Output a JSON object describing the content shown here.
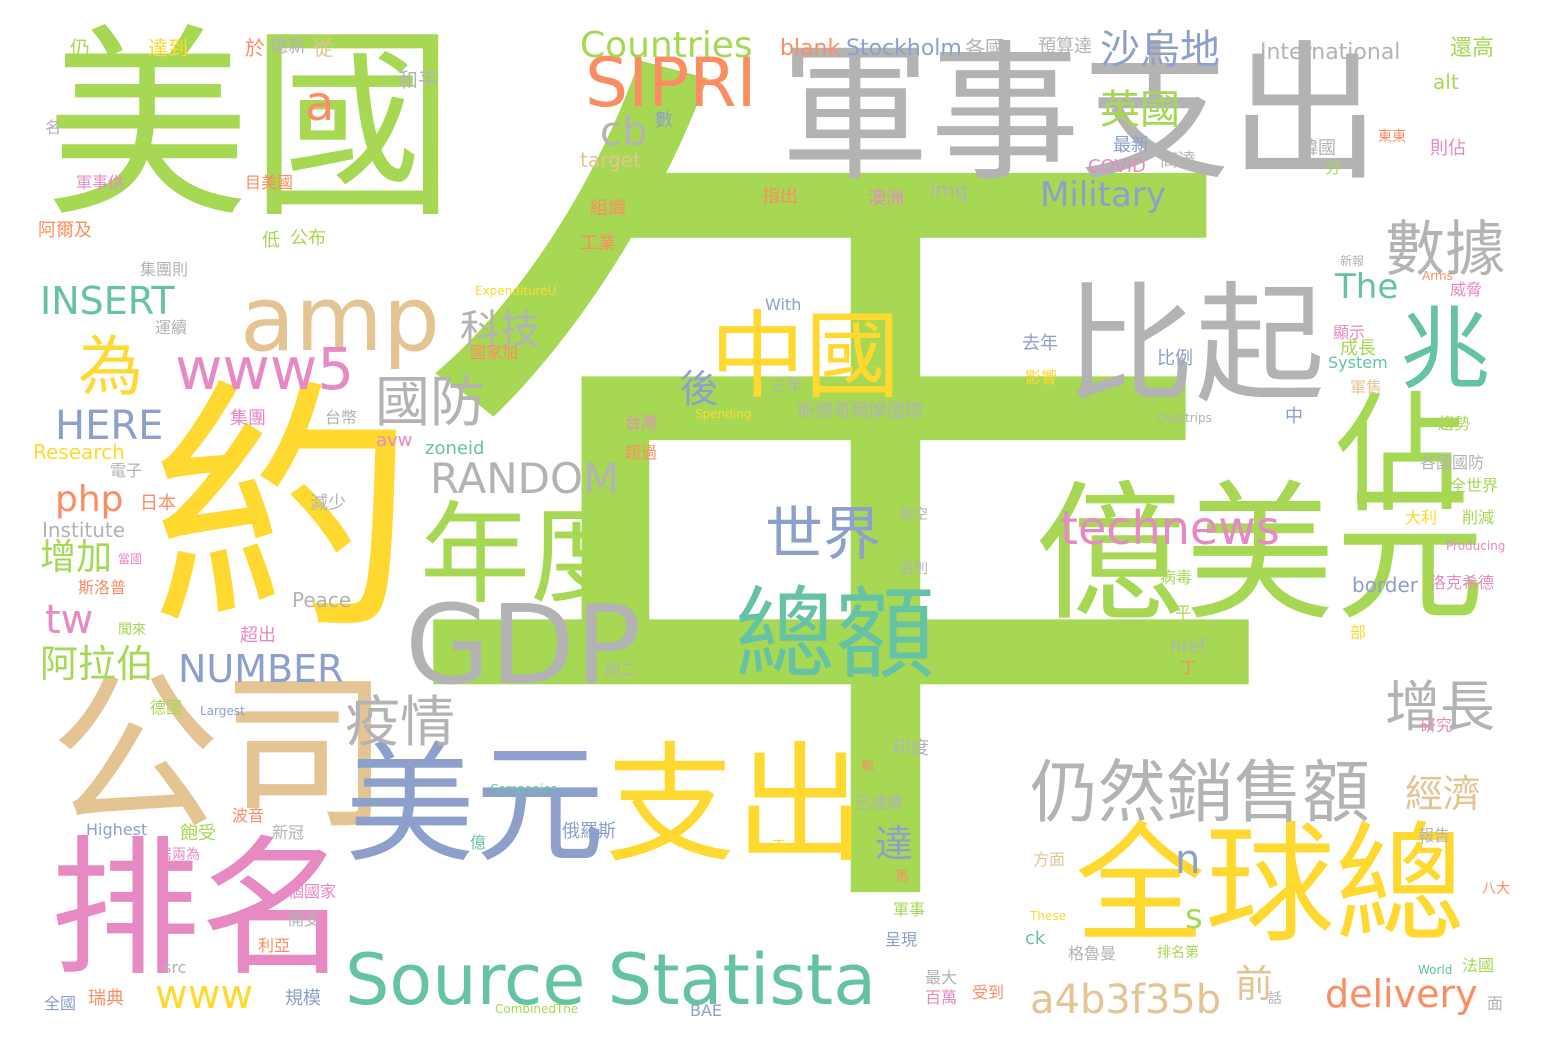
{
  "colors": {
    "green": "#a6d854",
    "yellow": "#ffd92f",
    "gray": "#b3b3b3",
    "tan": "#e5c494",
    "orange": "#fc8d62",
    "pink": "#e78ac3",
    "blue": "#8da0cb",
    "teal": "#66c2a5"
  },
  "words": [
    {
      "text": "年",
      "color": "green"
    },
    {
      "text": "美國",
      "color": "green"
    },
    {
      "text": "軍事支出",
      "color": "gray"
    },
    {
      "text": "約",
      "color": "yellow"
    },
    {
      "text": "億美元",
      "color": "green"
    },
    {
      "text": "公司",
      "color": "tan"
    },
    {
      "text": "排名",
      "color": "pink"
    },
    {
      "text": "比起",
      "color": "gray"
    },
    {
      "text": "美元",
      "color": "blue"
    },
    {
      "text": "支出",
      "color": "yellow"
    },
    {
      "text": "全球總",
      "color": "yellow"
    },
    {
      "text": "佔",
      "color": "green"
    },
    {
      "text": "GDP",
      "color": "gray"
    },
    {
      "text": "年度",
      "color": "green"
    },
    {
      "text": "總額",
      "color": "teal"
    },
    {
      "text": "中國",
      "color": "yellow"
    },
    {
      "text": "Source Statista",
      "color": "teal"
    },
    {
      "text": "amp",
      "color": "tan"
    },
    {
      "text": "仍然銷售額",
      "color": "gray"
    },
    {
      "text": "兆",
      "color": "teal"
    },
    {
      "text": "SIPRI",
      "color": "orange"
    },
    {
      "text": "數據",
      "color": "gray"
    },
    {
      "text": "www5",
      "color": "pink"
    },
    {
      "text": "國防",
      "color": "gray"
    },
    {
      "text": "世界",
      "color": "blue"
    },
    {
      "text": "technews",
      "color": "pink"
    },
    {
      "text": "疫情",
      "color": "gray"
    },
    {
      "text": "增長",
      "color": "gray"
    },
    {
      "text": "為",
      "color": "yellow"
    },
    {
      "text": "RANDOM",
      "color": "gray"
    },
    {
      "text": "a4b3f35b",
      "color": "tan"
    },
    {
      "text": "www",
      "color": "yellow"
    },
    {
      "text": "Countries",
      "color": "green"
    },
    {
      "text": "沙烏地",
      "color": "blue"
    },
    {
      "text": "英國",
      "color": "green"
    },
    {
      "text": "INSERT",
      "color": "teal"
    },
    {
      "text": "科技",
      "color": "gray"
    },
    {
      "text": "HERE",
      "color": "blue"
    },
    {
      "text": "NUMBER",
      "color": "blue"
    },
    {
      "text": "delivery",
      "color": "orange"
    },
    {
      "text": "a",
      "color": "orange"
    },
    {
      "text": "cb",
      "color": "gray"
    },
    {
      "text": "Military",
      "color": "blue"
    },
    {
      "text": "The",
      "color": "teal"
    },
    {
      "text": "php",
      "color": "orange"
    },
    {
      "text": "增加",
      "color": "green"
    },
    {
      "text": "tw",
      "color": "pink"
    },
    {
      "text": "阿拉伯",
      "color": "green"
    },
    {
      "text": "經濟",
      "color": "tan"
    },
    {
      "text": "後",
      "color": "blue"
    },
    {
      "text": "達",
      "color": "blue"
    },
    {
      "text": "前",
      "color": "tan"
    },
    {
      "text": "n",
      "color": "blue"
    },
    {
      "text": "s",
      "color": "green"
    },
    {
      "text": "blank",
      "color": "orange"
    },
    {
      "text": "Stockholm",
      "color": "blue"
    },
    {
      "text": "各國",
      "color": "gray"
    },
    {
      "text": "預算達",
      "color": "gray"
    },
    {
      "text": "International",
      "color": "gray"
    },
    {
      "text": "還高",
      "color": "green"
    },
    {
      "text": "alt",
      "color": "green"
    },
    {
      "text": "仍",
      "color": "green"
    },
    {
      "text": "達到",
      "color": "yellow"
    },
    {
      "text": "於",
      "color": "orange"
    },
    {
      "text": "億新",
      "color": "gray"
    },
    {
      "text": "從",
      "color": "tan"
    },
    {
      "text": "和平",
      "color": "gray"
    },
    {
      "text": "名",
      "color": "gray"
    },
    {
      "text": "數",
      "color": "blue"
    },
    {
      "text": "target",
      "color": "tan"
    },
    {
      "text": "最新",
      "color": "blue"
    },
    {
      "text": "COVID",
      "color": "pink"
    },
    {
      "text": "高達",
      "color": "gray"
    },
    {
      "text": "韓國",
      "color": "gray"
    },
    {
      "text": "東東",
      "color": "orange"
    },
    {
      "text": "則佔",
      "color": "pink"
    },
    {
      "text": "分",
      "color": "green"
    },
    {
      "text": "軍事供",
      "color": "pink"
    },
    {
      "text": "目美國",
      "color": "orange"
    },
    {
      "text": "指出",
      "color": "orange"
    },
    {
      "text": "澳洲",
      "color": "pink"
    },
    {
      "text": "img",
      "color": "gray"
    },
    {
      "text": "阿爾及",
      "color": "orange"
    },
    {
      "text": "組織",
      "color": "orange"
    },
    {
      "text": "低",
      "color": "green"
    },
    {
      "text": "公布",
      "color": "green"
    },
    {
      "text": "工業",
      "color": "orange"
    },
    {
      "text": "集團則",
      "color": "gray"
    },
    {
      "text": "ExpenditureU",
      "color": "yellow"
    },
    {
      "text": "新報",
      "color": "gray"
    },
    {
      "text": "Arms",
      "color": "orange"
    },
    {
      "text": "威脅",
      "color": "pink"
    },
    {
      "text": "運續",
      "color": "gray"
    },
    {
      "text": "With",
      "color": "blue"
    },
    {
      "text": "國家加",
      "color": "orange"
    },
    {
      "text": "去年",
      "color": "blue"
    },
    {
      "text": "顯示",
      "color": "pink"
    },
    {
      "text": "成長",
      "color": "green"
    },
    {
      "text": "System",
      "color": "teal"
    },
    {
      "text": "比例",
      "color": "blue"
    },
    {
      "text": "三年",
      "color": "gray"
    },
    {
      "text": "影響",
      "color": "yellow"
    },
    {
      "text": "軍售",
      "color": "tan"
    },
    {
      "text": "集團",
      "color": "pink"
    },
    {
      "text": "台幣",
      "color": "gray"
    },
    {
      "text": "台灣",
      "color": "pink"
    },
    {
      "text": "Spending",
      "color": "yellow"
    },
    {
      "text": "斯德哥爾摩國際",
      "color": "gray"
    },
    {
      "text": "Outstrips",
      "color": "gray"
    },
    {
      "text": "中",
      "color": "blue"
    },
    {
      "text": "趨勢",
      "color": "green"
    },
    {
      "text": "Research",
      "color": "yellow"
    },
    {
      "text": "avw",
      "color": "pink"
    },
    {
      "text": "zoneid",
      "color": "teal"
    },
    {
      "text": "超過",
      "color": "orange"
    },
    {
      "text": "電子",
      "color": "gray"
    },
    {
      "text": "日本",
      "color": "orange"
    },
    {
      "text": "各國國防",
      "color": "gray"
    },
    {
      "text": "全世界",
      "color": "green"
    },
    {
      "text": "Institute",
      "color": "gray"
    },
    {
      "text": "減少",
      "color": "gray"
    },
    {
      "text": "航空",
      "color": "gray"
    },
    {
      "text": "大利",
      "color": "yellow"
    },
    {
      "text": "削減",
      "color": "green"
    },
    {
      "text": "當國",
      "color": "pink"
    },
    {
      "text": "斯洛普",
      "color": "orange"
    },
    {
      "text": "Producing",
      "color": "pink"
    },
    {
      "text": "名則",
      "color": "gray"
    },
    {
      "text": "病毒",
      "color": "green"
    },
    {
      "text": "洛克希德",
      "color": "pink"
    },
    {
      "text": "Peace",
      "color": "gray"
    },
    {
      "text": "border",
      "color": "blue"
    },
    {
      "text": "聞來",
      "color": "green"
    },
    {
      "text": "超出",
      "color": "pink"
    },
    {
      "text": "平",
      "color": "green"
    },
    {
      "text": "部",
      "color": "yellow"
    },
    {
      "text": "href",
      "color": "gray"
    },
    {
      "text": "丁",
      "color": "orange"
    },
    {
      "text": "前二",
      "color": "gray"
    },
    {
      "text": "德國",
      "color": "green"
    },
    {
      "text": "Largest",
      "color": "blue"
    },
    {
      "text": "研究",
      "color": "pink"
    },
    {
      "text": "印度",
      "color": "gray"
    },
    {
      "text": "已連續",
      "color": "gray"
    },
    {
      "text": "Companies",
      "color": "teal"
    },
    {
      "text": "波音",
      "color": "orange"
    },
    {
      "text": "Highest",
      "color": "blue"
    },
    {
      "text": "飽受",
      "color": "green"
    },
    {
      "text": "新冠",
      "color": "gray"
    },
    {
      "text": "億",
      "color": "teal"
    },
    {
      "text": "俄羅斯",
      "color": "blue"
    },
    {
      "text": "報告",
      "color": "gray"
    },
    {
      "text": "居兩為",
      "color": "pink"
    },
    {
      "text": "方面",
      "color": "tan"
    },
    {
      "text": "個國家",
      "color": "pink"
    },
    {
      "text": "開支",
      "color": "gray"
    },
    {
      "text": "軍事",
      "color": "green"
    },
    {
      "text": "八大",
      "color": "orange"
    },
    {
      "text": "These",
      "color": "yellow"
    },
    {
      "text": "利亞",
      "color": "orange"
    },
    {
      "text": "呈現",
      "color": "blue"
    },
    {
      "text": "ck",
      "color": "teal"
    },
    {
      "text": "格魯曼",
      "color": "gray"
    },
    {
      "text": "排名第",
      "color": "green"
    },
    {
      "text": "src",
      "color": "gray"
    },
    {
      "text": "規模",
      "color": "blue"
    },
    {
      "text": "最大",
      "color": "gray"
    },
    {
      "text": "百萬",
      "color": "pink"
    },
    {
      "text": "受到",
      "color": "orange"
    },
    {
      "text": "World",
      "color": "teal"
    },
    {
      "text": "法國",
      "color": "green"
    },
    {
      "text": "全國",
      "color": "blue"
    },
    {
      "text": "瑞典",
      "color": "orange"
    },
    {
      "text": "CombinedThe",
      "color": "green"
    },
    {
      "text": "BAE",
      "color": "blue"
    },
    {
      "text": "話",
      "color": "gray"
    },
    {
      "text": "面",
      "color": "gray"
    },
    {
      "text": "馬",
      "color": "orange"
    },
    {
      "text": "干",
      "color": "yellow"
    },
    {
      "text": "戰",
      "color": "orange"
    }
  ]
}
